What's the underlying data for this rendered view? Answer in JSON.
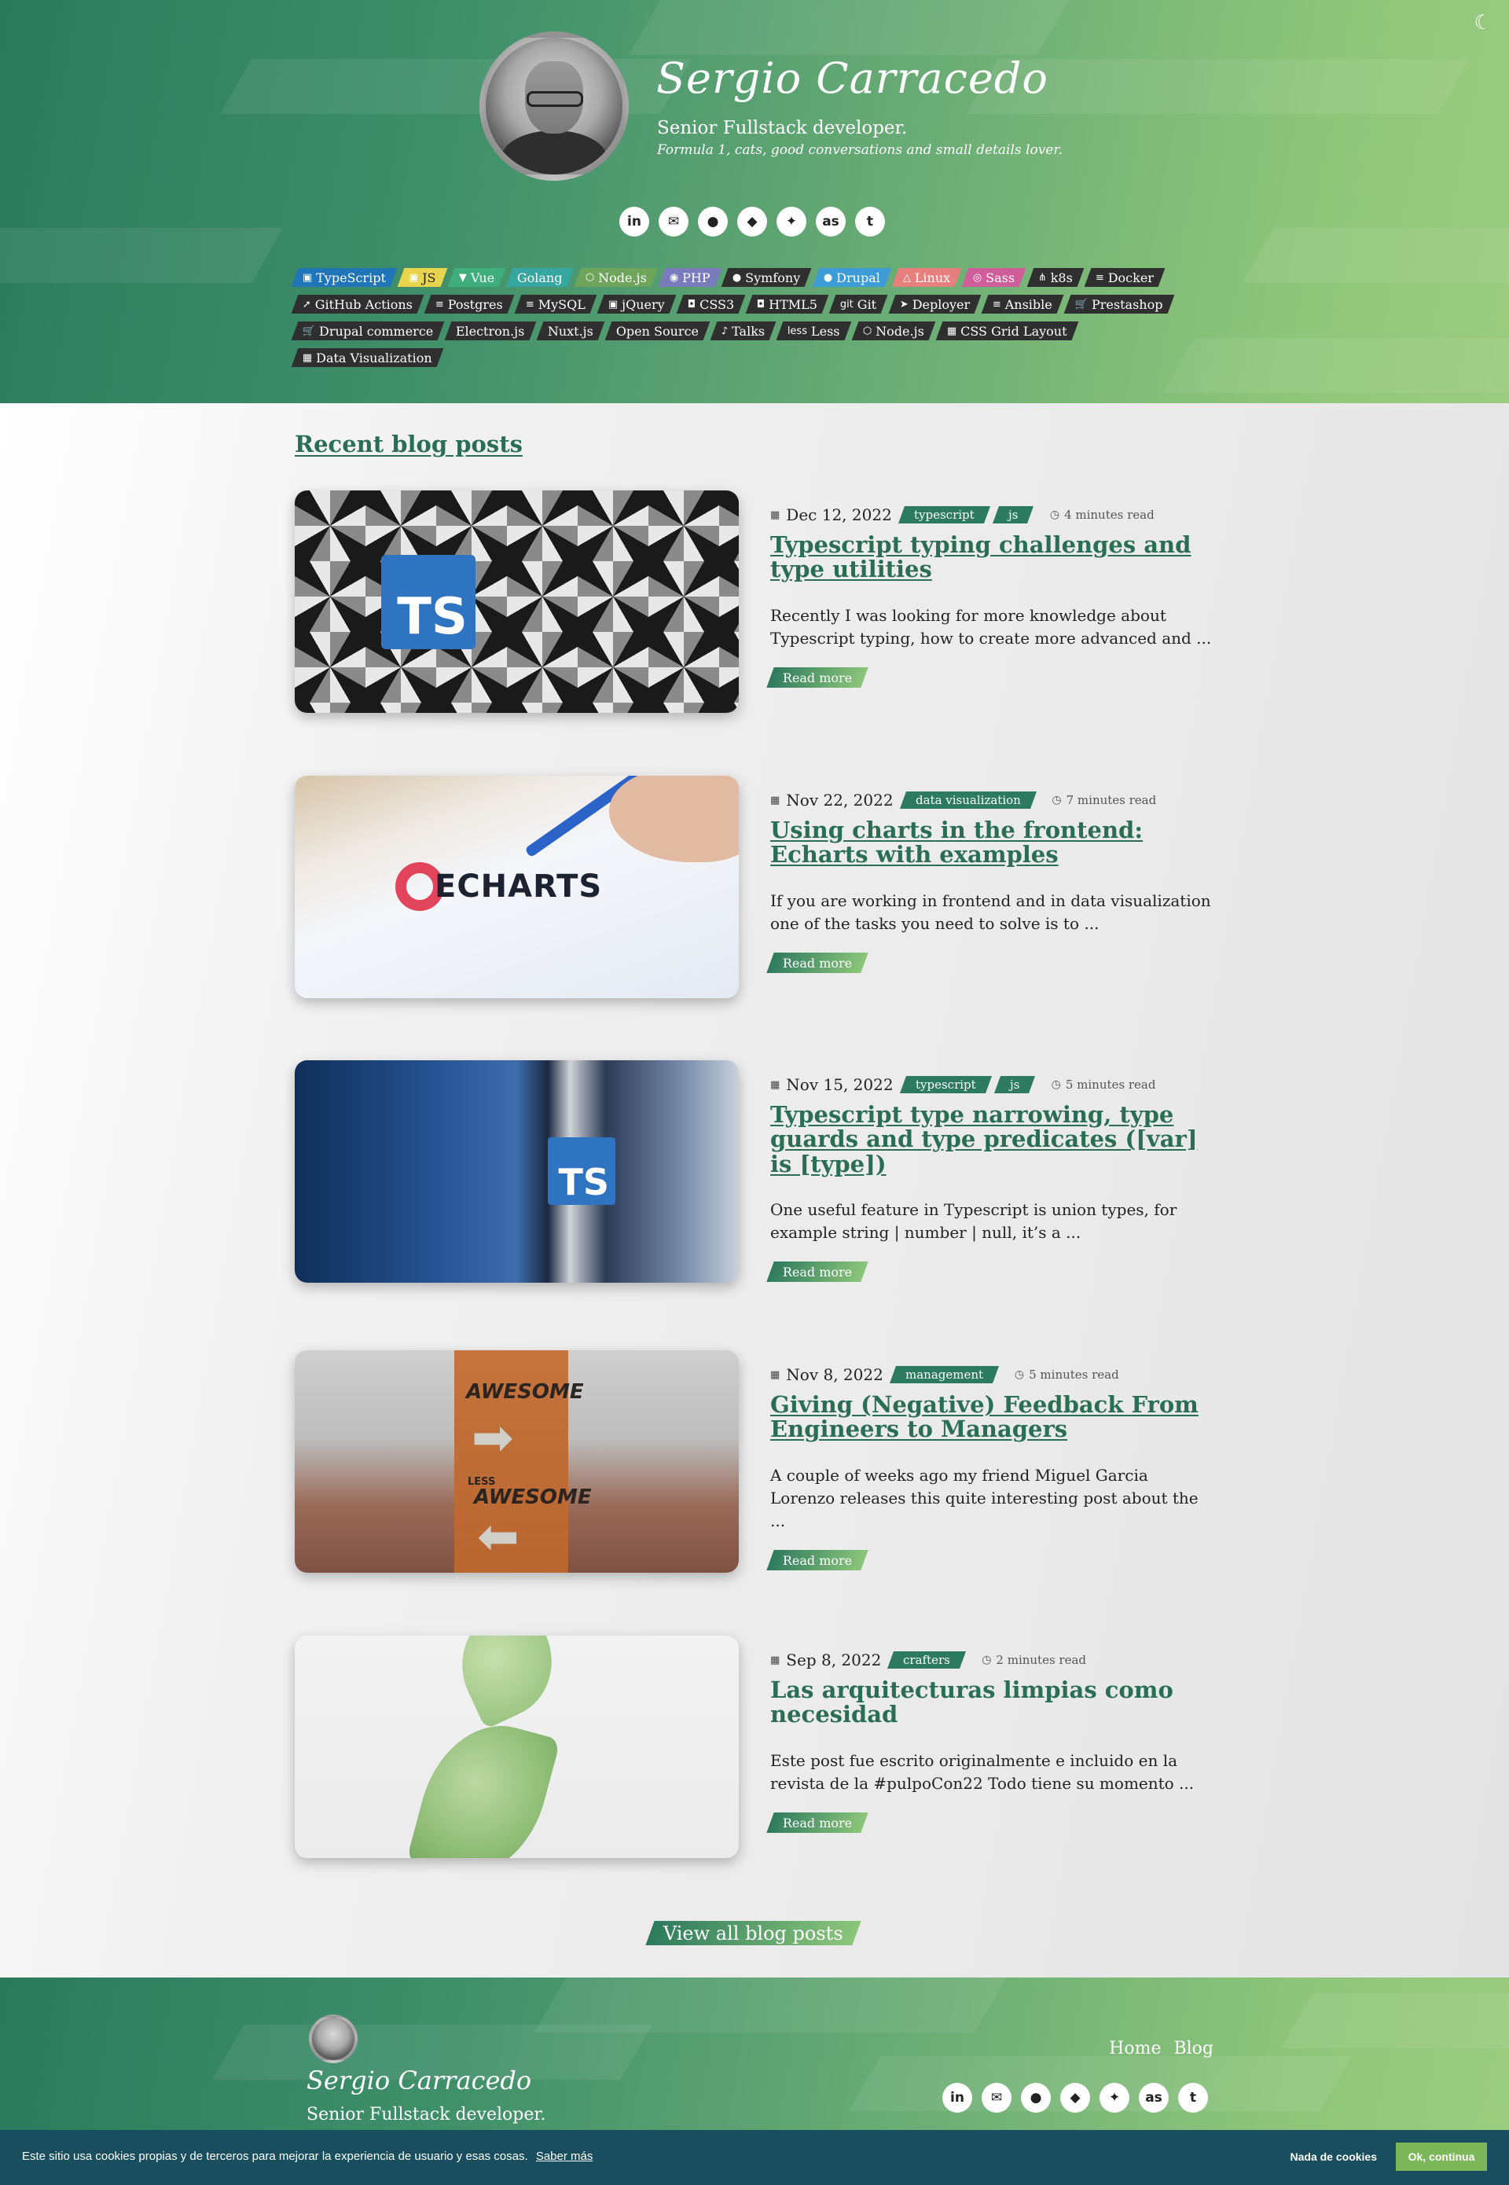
{
  "header": {
    "name": "Sergio Carracedo",
    "tagline": "Senior Fullstack developer.",
    "subtagline": "Formula 1, cats, good conversations and small details lover.",
    "theme_icon": "moon-icon"
  },
  "social": [
    {
      "name": "linkedin-icon",
      "glyph": "in"
    },
    {
      "name": "email-icon",
      "glyph": "✉"
    },
    {
      "name": "github-icon",
      "glyph": "●"
    },
    {
      "name": "drupal-icon",
      "glyph": "◆"
    },
    {
      "name": "twitter-icon",
      "glyph": "✦"
    },
    {
      "name": "lastfm-icon",
      "glyph": "as"
    },
    {
      "name": "tumblr-icon",
      "glyph": "t"
    }
  ],
  "skills": [
    {
      "label": "TypeScript",
      "icon": "▣",
      "color": "#1f75b8"
    },
    {
      "label": "JS",
      "icon": "▣",
      "color": "#e9d44d",
      "text": "#222"
    },
    {
      "label": "Vue",
      "icon": "▼",
      "color": "#3fae7c"
    },
    {
      "label": "Golang",
      "icon": "",
      "color": "#35a6a0"
    },
    {
      "label": "Node.js",
      "icon": "⬡",
      "color": "#6fa55a"
    },
    {
      "label": "PHP",
      "icon": "◉",
      "color": "#7a7bbd"
    },
    {
      "label": "Symfony",
      "icon": "●",
      "color": "#2f2f2f"
    },
    {
      "label": "Drupal",
      "icon": "●",
      "color": "#3d9bd6"
    },
    {
      "label": "Linux",
      "icon": "△",
      "color": "#e87f7f"
    },
    {
      "label": "Sass",
      "icon": "◎",
      "color": "#cf5d9a"
    },
    {
      "label": "k8s",
      "icon": "⋔",
      "color": "#2f2f2f"
    },
    {
      "label": "Docker",
      "icon": "≡",
      "color": "#2f2f2f"
    },
    {
      "label": "GitHub Actions",
      "icon": "➚",
      "color": "#2f2f2f"
    },
    {
      "label": "Postgres",
      "icon": "≡",
      "color": "#2f2f2f"
    },
    {
      "label": "MySQL",
      "icon": "≡",
      "color": "#2f2f2f"
    },
    {
      "label": "jQuery",
      "icon": "▣",
      "color": "#2f2f2f"
    },
    {
      "label": "CSS3",
      "icon": "◘",
      "color": "#2f2f2f"
    },
    {
      "label": "HTML5",
      "icon": "◘",
      "color": "#2f2f2f"
    },
    {
      "label": "Git",
      "icon": "git",
      "color": "#2f2f2f"
    },
    {
      "label": "Deployer",
      "icon": "➤",
      "color": "#2f2f2f"
    },
    {
      "label": "Ansible",
      "icon": "≡",
      "color": "#2f2f2f"
    },
    {
      "label": "Prestashop",
      "icon": "🛒",
      "color": "#2f2f2f"
    },
    {
      "label": "Drupal commerce",
      "icon": "🛒",
      "color": "#2f2f2f"
    },
    {
      "label": "Electron.js",
      "icon": "",
      "color": "#2f2f2f"
    },
    {
      "label": "Nuxt.js",
      "icon": "",
      "color": "#2f2f2f"
    },
    {
      "label": "Open Source",
      "icon": "",
      "color": "#2f2f2f"
    },
    {
      "label": "Talks",
      "icon": "♪",
      "color": "#2f2f2f"
    },
    {
      "label": "Less",
      "icon": "less",
      "color": "#2f2f2f"
    },
    {
      "label": "Node.js",
      "icon": "⬡",
      "color": "#2f2f2f"
    },
    {
      "label": "CSS Grid Layout",
      "icon": "▦",
      "color": "#2f2f2f"
    },
    {
      "label": "Data Visualization",
      "icon": "▦",
      "color": "#2f2f2f"
    }
  ],
  "blog": {
    "section_title": "Recent blog posts",
    "read_more": "Read more",
    "view_all": "View all blog posts",
    "posts": [
      {
        "date": "Dec 12, 2022",
        "tags": [
          "typescript",
          "js"
        ],
        "read_time": "4 minutes read",
        "title": "Typescript typing challenges and type utilities",
        "excerpt": "Recently I was looking for more knowledge about Typescript typing, how to create more advanced and ...",
        "image": "typescript-geometric-image",
        "badge": "TS"
      },
      {
        "date": "Nov 22, 2022",
        "tags": [
          "data visualization"
        ],
        "read_time": "7 minutes read",
        "title": "Using charts in the frontend: Echarts with examples",
        "excerpt": "If you are working in frontend and in data visualization one of the tasks you need to solve is to ...",
        "image": "echarts-logo-image",
        "badge": "ECHARTS"
      },
      {
        "date": "Nov 15, 2022",
        "tags": [
          "typescript",
          "js"
        ],
        "read_time": "5 minutes read",
        "title": "Typescript type narrowing, type guards and type predicates ([var] is [type])",
        "excerpt": "One useful feature in Typescript is union types, for example string | number | null, it’s a ...",
        "image": "typescript-blue-corridor-image",
        "badge": "TS"
      },
      {
        "date": "Nov 8, 2022",
        "tags": [
          "management"
        ],
        "read_time": "5 minutes read",
        "title": "Giving (Negative) Feedback From Engineers to Managers",
        "excerpt": "A couple of weeks ago my friend Miguel Garcia Lorenzo releases this quite interesting post about the ...",
        "image": "awesome-sign-image",
        "sign_top": "AWESOME",
        "sign_mid": "LESS",
        "sign_bottom": "AWESOME"
      },
      {
        "date": "Sep 8, 2022",
        "tags": [
          "crafters"
        ],
        "read_time": "2 minutes read",
        "title": "Las arquitecturas limpias como necesidad",
        "excerpt": "Este post fue escrito originalmente e incluido en la revista de la #pulpoCon22 Todo tiene su momento ...",
        "image": "green-leaf-image"
      }
    ]
  },
  "footer": {
    "name": "Sergio Carracedo",
    "tagline": "Senior Fullstack developer.",
    "nav": [
      "Home",
      "Blog"
    ]
  },
  "cookie": {
    "message": "Este sitio usa cookies propias y de terceros para mejorar la experiencia de usuario y esas cosas.",
    "more": "Saber más",
    "deny": "Nada de cookies",
    "accept": "Ok, continua"
  }
}
